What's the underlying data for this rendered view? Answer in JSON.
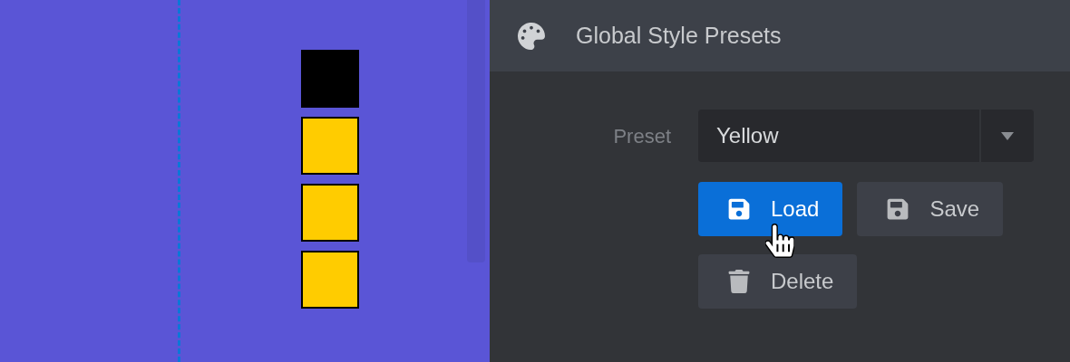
{
  "canvas": {
    "blocks": [
      {
        "color": "#000000"
      },
      {
        "color": "#ffcc00"
      },
      {
        "color": "#ffcc00"
      },
      {
        "color": "#ffcc00"
      }
    ]
  },
  "panel": {
    "title": "Global Style Presets",
    "preset": {
      "label": "Preset",
      "value": "Yellow"
    },
    "buttons": [
      {
        "label": "Load",
        "kind": "load",
        "hovered": true
      },
      {
        "label": "Save",
        "kind": "save",
        "hovered": false
      },
      {
        "label": "Delete",
        "kind": "delete",
        "hovered": false
      }
    ]
  }
}
